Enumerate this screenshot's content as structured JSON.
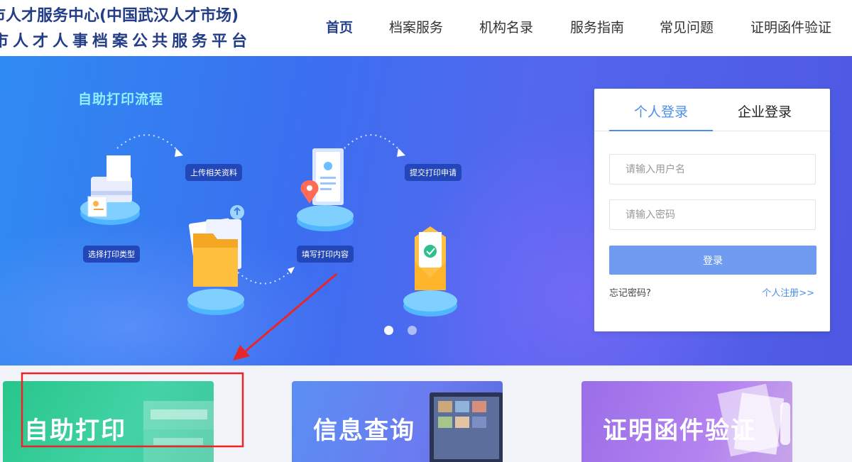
{
  "header": {
    "logo_line1": "市人才服务中心(中国武汉人才市场)",
    "logo_line2": "市人才人事档案公共服务平台"
  },
  "nav": {
    "items": [
      {
        "label": "首页",
        "active": true
      },
      {
        "label": "档案服务"
      },
      {
        "label": "机构名录"
      },
      {
        "label": "服务指南"
      },
      {
        "label": "常见问题"
      },
      {
        "label": "证明函件验证"
      }
    ]
  },
  "banner": {
    "title": "自助打印流程",
    "steps": [
      "选择打印类型",
      "上传相关资料",
      "填写打印内容",
      "提交打印申请"
    ],
    "carousel_dots": 2,
    "active_dot": 1
  },
  "login": {
    "tabs": [
      "个人登录",
      "企业登录"
    ],
    "active_tab": 0,
    "username_placeholder": "请输入用户名",
    "password_placeholder": "请输入密码",
    "submit_label": "登录",
    "forgot_label": "忘记密码?",
    "register_label": "个人注册>>"
  },
  "cards": [
    {
      "label": "自助打印"
    },
    {
      "label": "信息查询"
    },
    {
      "label": "证明函件验证"
    }
  ],
  "colors": {
    "brand": "#233d86",
    "accent": "#4a8ee8",
    "annotation": "#e8262a"
  }
}
